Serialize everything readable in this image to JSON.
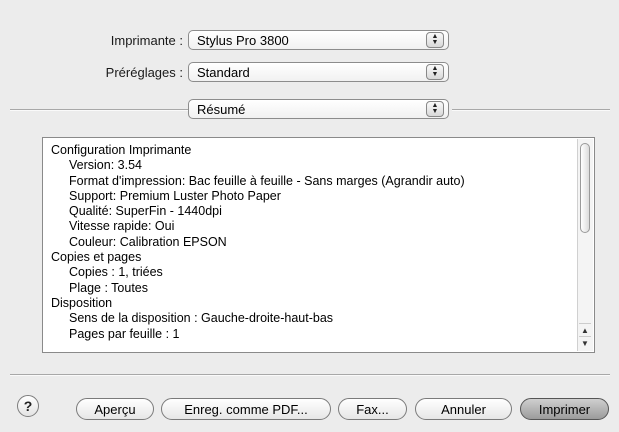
{
  "printer": {
    "label": "Imprimante :",
    "value": "Stylus Pro 3800"
  },
  "presets": {
    "label": "Préréglages :",
    "value": "Standard"
  },
  "panel": {
    "value": "Résumé"
  },
  "summary": {
    "lines": [
      {
        "text": "Configuration Imprimante",
        "indent": 0
      },
      {
        "text": "Version:  3.54",
        "indent": 1
      },
      {
        "text": "Format d'impression:  Bac feuille à feuille - Sans marges (Agrandir auto)",
        "indent": 1
      },
      {
        "text": "Support:  Premium Luster Photo Paper",
        "indent": 1
      },
      {
        "text": "Qualité:  SuperFin - 1440dpi",
        "indent": 1
      },
      {
        "text": "Vitesse rapide:  Oui",
        "indent": 1
      },
      {
        "text": "Couleur:  Calibration EPSON",
        "indent": 1
      },
      {
        "text": "Copies et pages",
        "indent": 0
      },
      {
        "text": "Copies :  1, triées",
        "indent": 1
      },
      {
        "text": "Plage :  Toutes",
        "indent": 1
      },
      {
        "text": "Disposition",
        "indent": 0
      },
      {
        "text": "Sens de la disposition :  Gauche-droite-haut-bas",
        "indent": 1
      },
      {
        "text": "Pages par feuille :  1",
        "indent": 1
      }
    ]
  },
  "buttons": {
    "help": "?",
    "preview": "Aperçu",
    "save_pdf": "Enreg. comme PDF...",
    "fax": "Fax...",
    "cancel": "Annuler",
    "print": "Imprimer"
  },
  "icons": {
    "popup_arrows": "up-down-arrows-icon",
    "help": "help-icon"
  }
}
